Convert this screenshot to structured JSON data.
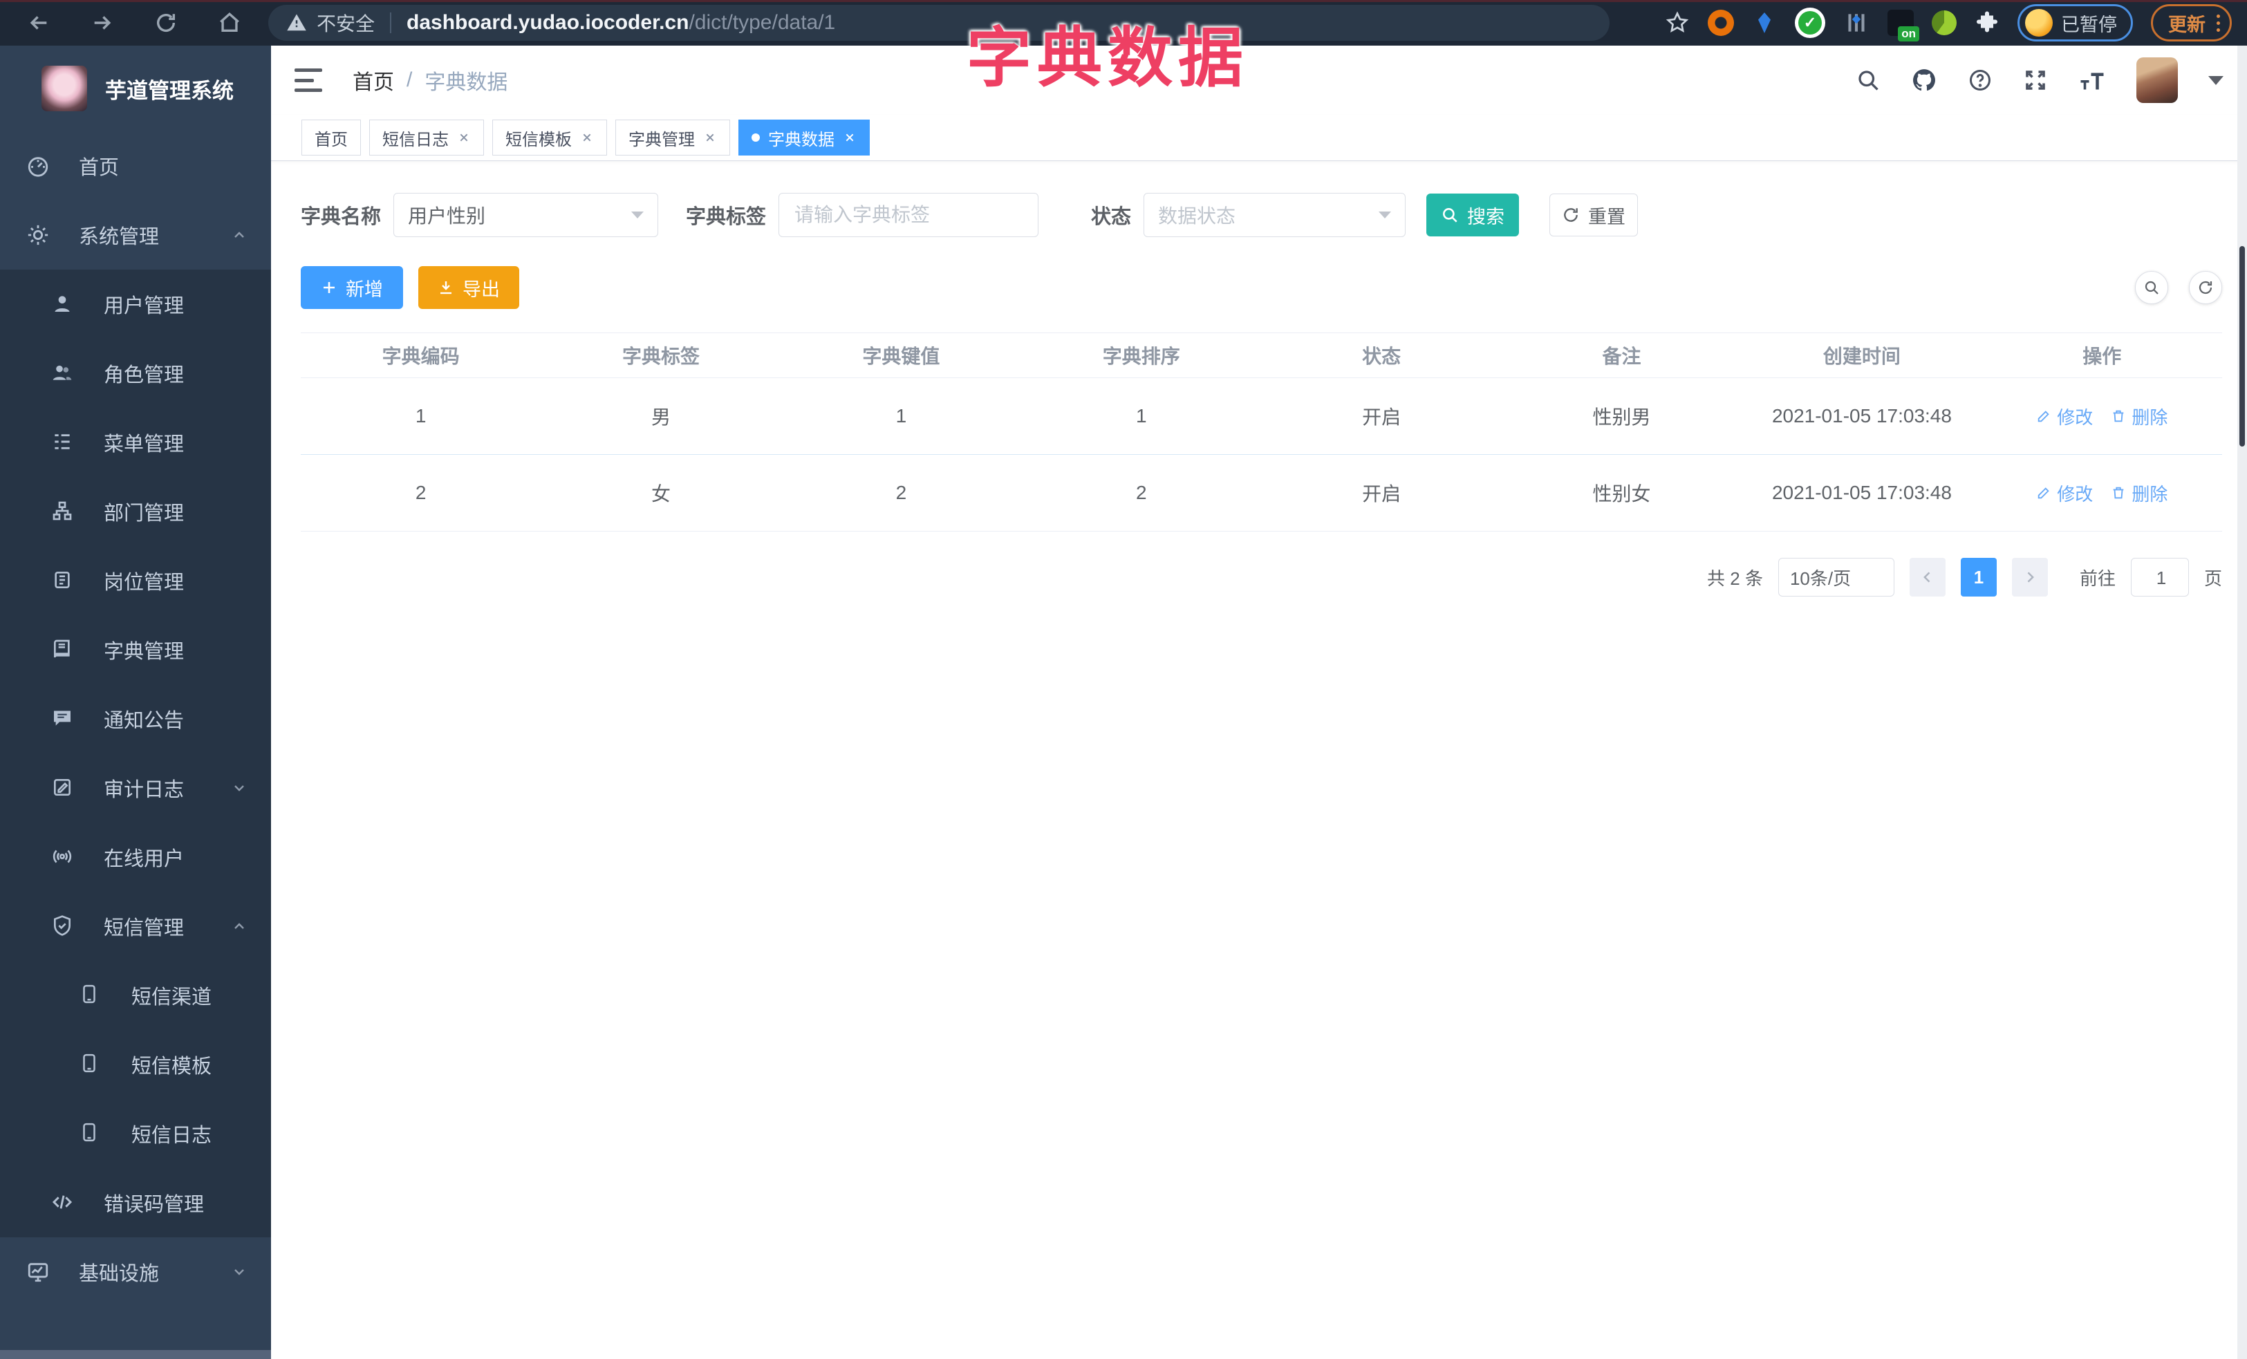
{
  "browser": {
    "security": "不安全",
    "url_host": "dashboard.yudao.iocoder.cn",
    "url_path": "/dict/type/data/1",
    "on_badge": "on",
    "paused": "已暂停",
    "update": "更新"
  },
  "overlay_title": "字典数据",
  "sidebar": {
    "title": "芋道管理系统",
    "items": [
      {
        "label": "首页",
        "icon": "dashboard-icon"
      },
      {
        "label": "系统管理",
        "icon": "gear-icon"
      },
      {
        "label": "用户管理",
        "icon": "user-icon"
      },
      {
        "label": "角色管理",
        "icon": "users-icon"
      },
      {
        "label": "菜单管理",
        "icon": "menu-list-icon"
      },
      {
        "label": "部门管理",
        "icon": "org-tree-icon"
      },
      {
        "label": "岗位管理",
        "icon": "badge-icon"
      },
      {
        "label": "字典管理",
        "icon": "book-icon"
      },
      {
        "label": "通知公告",
        "icon": "announcement-icon"
      },
      {
        "label": "审计日志",
        "icon": "audit-log-icon"
      },
      {
        "label": "在线用户",
        "icon": "online-users-icon"
      },
      {
        "label": "短信管理",
        "icon": "shield-check-icon"
      },
      {
        "label": "短信渠道",
        "icon": "phone-icon"
      },
      {
        "label": "短信模板",
        "icon": "phone-icon"
      },
      {
        "label": "短信日志",
        "icon": "phone-icon"
      },
      {
        "label": "错误码管理",
        "icon": "code-icon"
      },
      {
        "label": "基础设施",
        "icon": "monitor-icon"
      }
    ]
  },
  "breadcrumb": {
    "home": "首页",
    "sep": "/",
    "current": "字典数据"
  },
  "tags": [
    {
      "label": "首页"
    },
    {
      "label": "短信日志"
    },
    {
      "label": "短信模板"
    },
    {
      "label": "字典管理"
    },
    {
      "label": "字典数据"
    }
  ],
  "filters": {
    "name_label": "字典名称",
    "name_value": "用户性别",
    "tag_label": "字典标签",
    "tag_placeholder": "请输入字典标签",
    "status_label": "状态",
    "status_placeholder": "数据状态",
    "search": "搜索",
    "reset": "重置"
  },
  "toolbar": {
    "add": "新增",
    "export": "导出"
  },
  "table": {
    "columns": [
      "字典编码",
      "字典标签",
      "字典键值",
      "字典排序",
      "状态",
      "备注",
      "创建时间",
      "操作"
    ],
    "rows": [
      {
        "code": "1",
        "label": "男",
        "value": "1",
        "sort": "1",
        "status": "开启",
        "remark": "性别男",
        "created": "2021-01-05 17:03:48"
      },
      {
        "code": "2",
        "label": "女",
        "value": "2",
        "sort": "2",
        "status": "开启",
        "remark": "性别女",
        "created": "2021-01-05 17:03:48"
      }
    ],
    "edit": "修改",
    "delete": "删除"
  },
  "pagination": {
    "total": "共 2 条",
    "page_size": "10条/页",
    "current_page": "1",
    "goto_label": "前往",
    "goto_value": "1",
    "page_unit": "页"
  },
  "colors": {
    "primary": "#409EFF",
    "search_teal": "#23B8A8",
    "export_orange": "#F3A212",
    "overlay_red": "#EE3F63",
    "sidebar_bg": "#304156",
    "submenu_bg": "#263445",
    "chrome_bg": "#1E2836",
    "link_blue": "#68A9F7"
  }
}
